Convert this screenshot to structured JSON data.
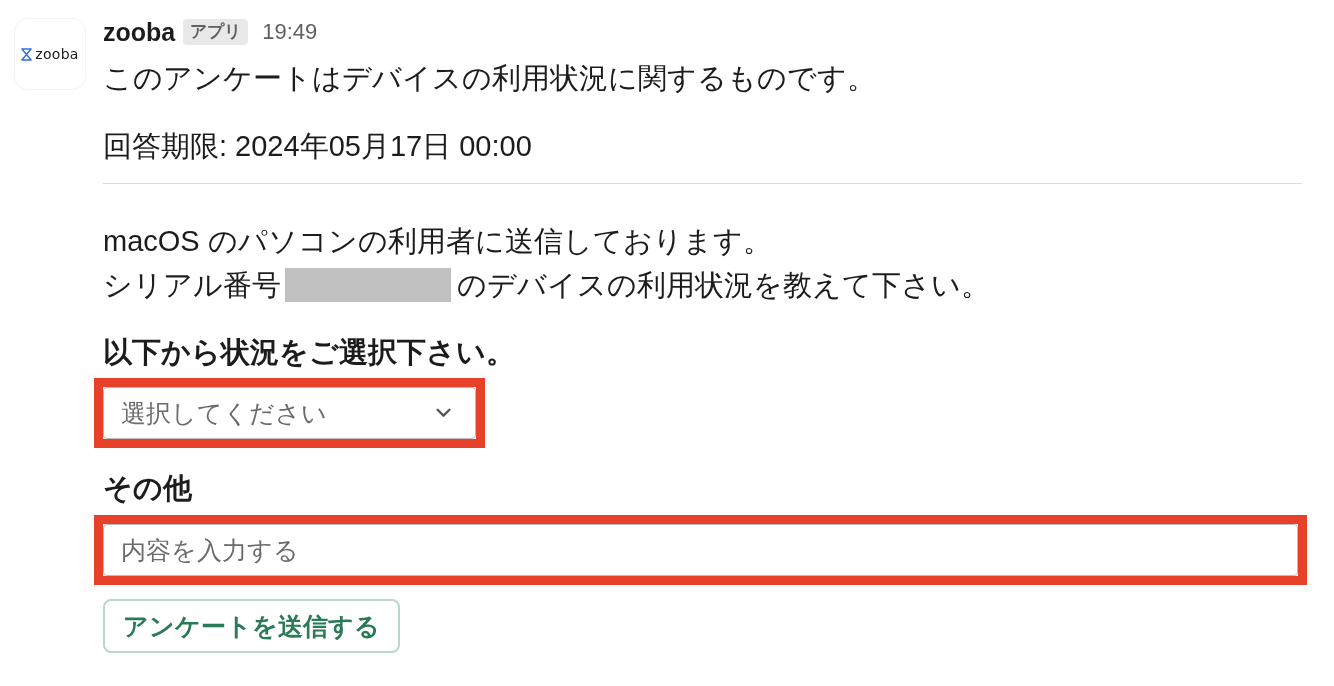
{
  "message": {
    "avatar": {
      "logo_text": "zooba"
    },
    "sender": "zooba",
    "badge": "アプリ",
    "time": "19:49",
    "intro": "このアンケートはデバイスの利用状況に関するものです。",
    "deadline": "回答期限: 2024年05月17日 00:00",
    "body_lines": [
      [
        {
          "kind": "text",
          "text": "macOS のパソコンの利用者に送信しております。"
        }
      ],
      [
        {
          "kind": "text",
          "text": "シリアル番号"
        },
        {
          "kind": "redacted"
        },
        {
          "kind": "text",
          "text": "のデバイスの利用状況を教えて下さい。"
        }
      ]
    ],
    "form": {
      "fields": [
        {
          "kind": "select",
          "label": "以下から状況をご選択下さい。",
          "placeholder": "選択してください",
          "highlighted": true
        },
        {
          "kind": "text",
          "label": "その他",
          "placeholder": "内容を入力する",
          "highlighted": true
        }
      ],
      "submit_button": "アンケートを送信する"
    }
  }
}
